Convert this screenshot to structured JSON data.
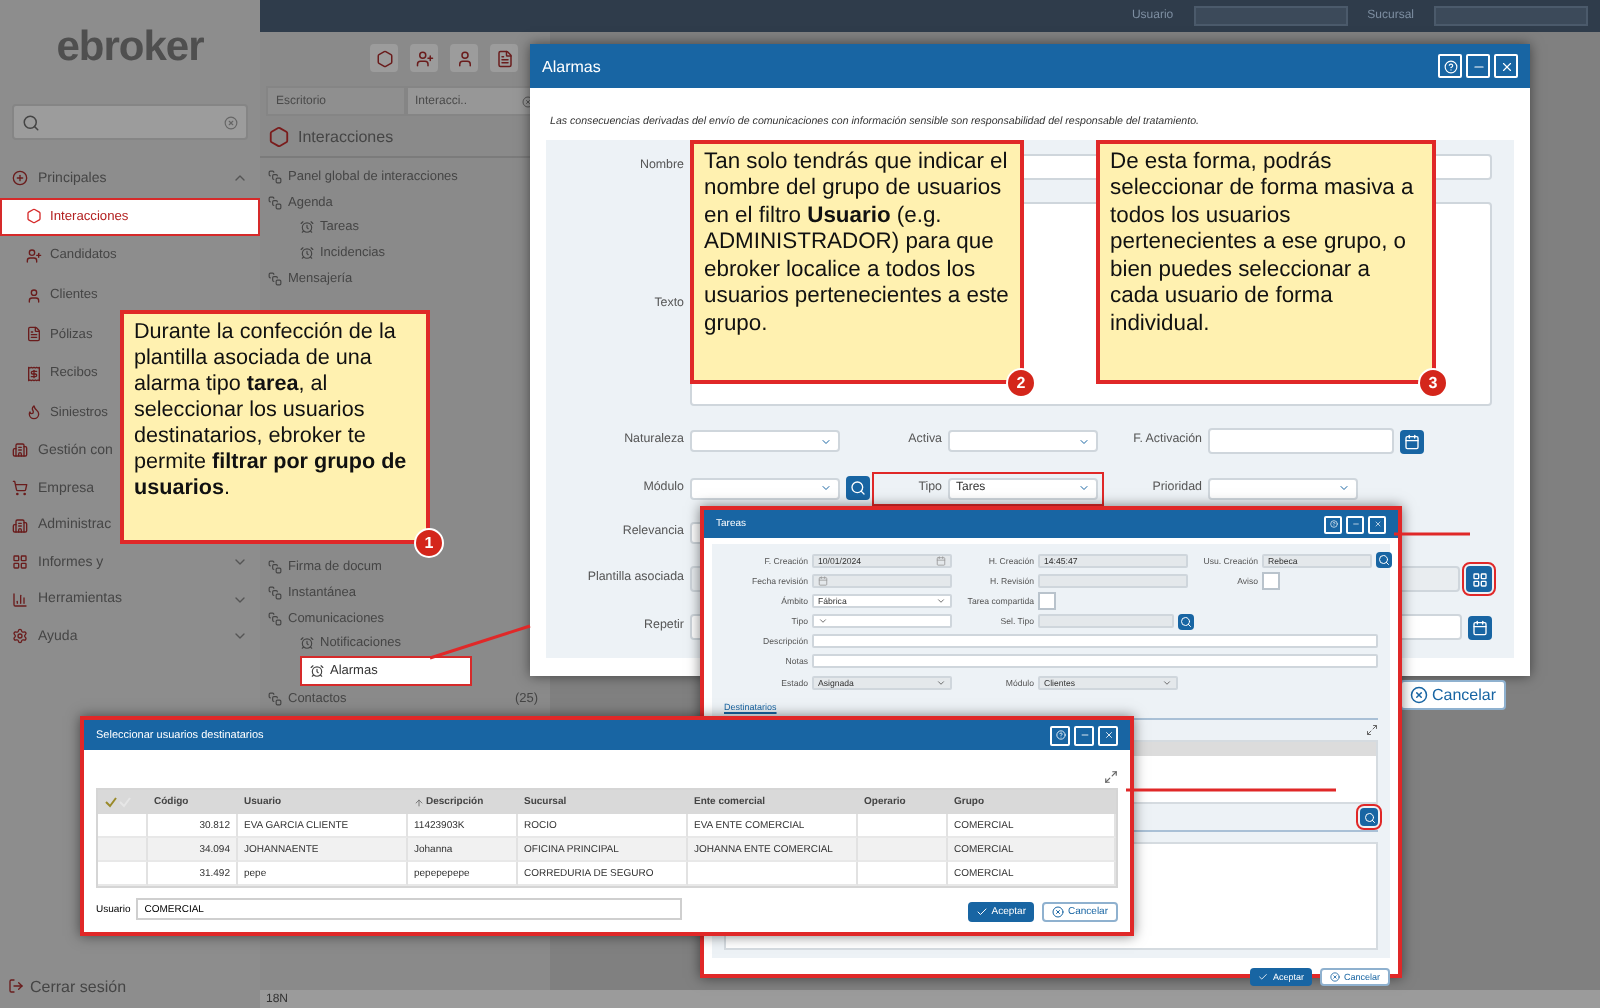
{
  "top_bar": {
    "user_label": "Usuario",
    "branch_label": "Sucursal"
  },
  "logo": "ebroker",
  "sidebar": {
    "groups": [
      {
        "label": "Principales",
        "expanded": true,
        "children": [
          {
            "label": "Interacciones",
            "selected": true
          },
          {
            "label": "Candidatos",
            "selected": false
          },
          {
            "label": "Clientes",
            "selected": false
          },
          {
            "label": "Pólizas",
            "selected": false
          },
          {
            "label": "Recibos",
            "selected": false
          },
          {
            "label": "Siniestros",
            "selected": false
          }
        ]
      },
      {
        "label": "Gestión con",
        "expanded": false
      },
      {
        "label": "Empresa",
        "expanded": false
      },
      {
        "label": "Administrac",
        "expanded": false
      },
      {
        "label": "Informes y",
        "expanded": false
      },
      {
        "label": "Herramientas",
        "expanded": false
      },
      {
        "label": "Ayuda",
        "expanded": false
      }
    ],
    "logout": "Cerrar sesión"
  },
  "tabs": [
    {
      "label": "Escritorio",
      "selected": false
    },
    {
      "label": "Interacci..",
      "selected": true
    }
  ],
  "section_title": "Interacciones",
  "tree": [
    {
      "label": "Panel global de interacciones",
      "selected": false
    },
    {
      "label": "Agenda",
      "selected": false,
      "children": [
        {
          "label": "Tareas",
          "selected": false
        },
        {
          "label": "Incidencias",
          "selected": false
        }
      ]
    },
    {
      "label": "Mensajería",
      "selected": false
    }
  ],
  "tree_continued": [
    {
      "label": "Firma de docum",
      "selected": false
    },
    {
      "label": "Instantánea",
      "selected": false
    },
    {
      "label": "Comunicaciones",
      "selected": false,
      "children": [
        {
          "label": "Notificaciones",
          "selected": false
        },
        {
          "label": "Alarmas",
          "selected": true
        }
      ]
    },
    {
      "label": "Contactos",
      "selected": false,
      "count": "(25)"
    }
  ],
  "status": "18N",
  "alarm_dialog": {
    "title": "Alarmas",
    "notice": "Las consecuencias derivadas del envío de comunicaciones con información sensible son responsabilidad del responsable del tratamiento.",
    "rows": [
      [
        {
          "label": "Nombre",
          "kind": "text",
          "highlighted": false
        }
      ],
      [
        {
          "label": "Texto",
          "kind": "textarea",
          "highlighted": false
        }
      ],
      [
        {
          "label": "Naturaleza",
          "kind": "select",
          "highlighted": false
        },
        {
          "label": "Activa",
          "kind": "select",
          "highlighted": false
        },
        {
          "label": "F. Activación",
          "kind": "date",
          "highlighted": false
        }
      ],
      [
        {
          "label": "Módulo",
          "kind": "lookup",
          "highlighted": false
        },
        {
          "label": "Tipo",
          "kind": "select",
          "value": "Tares",
          "highlighted": true
        },
        {
          "label": "Prioridad",
          "kind": "select",
          "highlighted": false
        }
      ],
      [
        {
          "label": "Relevancia",
          "kind": "select",
          "highlighted": false
        }
      ],
      [
        {
          "label": "Plantilla asociada",
          "kind": "picker",
          "highlighted": true
        }
      ],
      [
        {
          "label": "Repetir",
          "kind": "date",
          "highlighted": false
        }
      ]
    ],
    "cancel": "Cancelar"
  },
  "callouts": [
    {
      "number": "1",
      "text": "Durante la confección de la plantilla asociada de una alarma tipo **tarea**, al seleccionar los usuarios destinatarios, ebroker te permite **filtrar por grupo de usuarios**."
    },
    {
      "number": "2",
      "text": "Tan solo tendrás que indicar el nombre del grupo de usuarios en el filtro **Usuario** (e.g. ADMINISTRADOR) para que ebroker localice a todos los usuarios pertenecientes a este grupo."
    },
    {
      "number": "3",
      "text": "De esta forma, podrás seleccionar de forma masiva a todos los usuarios pertenecientes a ese grupo, o bien puedes seleccionar a cada usuario de forma individual."
    }
  ],
  "task_dialog": {
    "title": "Tareas",
    "rows": [
      [
        {
          "label": "F. Creación",
          "kind": "date",
          "value": "10/01/2024",
          "disabled": true
        },
        {
          "label": "H. Creación",
          "kind": "text",
          "value": "14:45:47",
          "disabled": true
        },
        {
          "label": "Usu. Creación",
          "kind": "lookup",
          "value": "Rebeca",
          "disabled": true
        }
      ],
      [
        {
          "label": "Fecha revisión",
          "kind": "date",
          "disabled": true
        },
        {
          "label": "H. Revisión",
          "kind": "text",
          "disabled": true
        },
        {
          "label": "Aviso",
          "kind": "checkbox",
          "checked": false,
          "disabled": false
        }
      ],
      [
        {
          "label": "Ámbito",
          "kind": "select",
          "value": "Fábrica",
          "disabled": false
        },
        {
          "label": "Tarea compartida",
          "kind": "checkbox",
          "checked": false,
          "disabled": false
        }
      ],
      [
        {
          "label": "Tipo",
          "kind": "select",
          "disabled": false
        },
        {
          "label": "Sel. Tipo",
          "kind": "lookup",
          "disabled": true
        }
      ],
      [
        {
          "label": "Descripción",
          "kind": "wide",
          "disabled": false
        }
      ],
      [
        {
          "label": "Notas",
          "kind": "wide",
          "disabled": false
        }
      ],
      [
        {
          "label": "Estado",
          "kind": "select",
          "value": "Asignada",
          "disabled": true
        },
        {
          "label": "Módulo",
          "kind": "select",
          "value": "Clientes",
          "disabled": true
        }
      ]
    ],
    "recipients_link": "Destinatarios",
    "accept": "Aceptar",
    "cancel": "Cancelar"
  },
  "users_dialog": {
    "title": "Seleccionar usuarios destinatarios",
    "columns": [
      {
        "label": "Código",
        "sorted": false
      },
      {
        "label": "Usuario",
        "sorted": false
      },
      {
        "label": "Descripción",
        "sorted": true
      },
      {
        "label": "Sucursal",
        "sorted": false
      },
      {
        "label": "Ente comercial",
        "sorted": false
      },
      {
        "label": "Operario",
        "sorted": false
      },
      {
        "label": "Grupo",
        "sorted": false
      }
    ],
    "rows": [
      [
        "30.812",
        "EVA GARCIA CLIENTE",
        "11423903K",
        "ROCIO",
        "EVA ENTE COMERCIAL",
        "",
        "COMERCIAL"
      ],
      [
        "34.094",
        "JOHANNAENTE",
        "Johanna",
        "OFICINA PRINCIPAL",
        "JOHANNA ENTE COMERCIAL",
        "",
        "COMERCIAL"
      ],
      [
        "31.492",
        "pepe",
        "pepepepepe",
        "CORREDURIA DE SEGURO",
        "",
        "",
        "COMERCIAL"
      ]
    ],
    "filter_label": "Usuario",
    "filter_value": "COMERCIAL",
    "accept": "Aceptar",
    "cancel": "Cancelar"
  }
}
